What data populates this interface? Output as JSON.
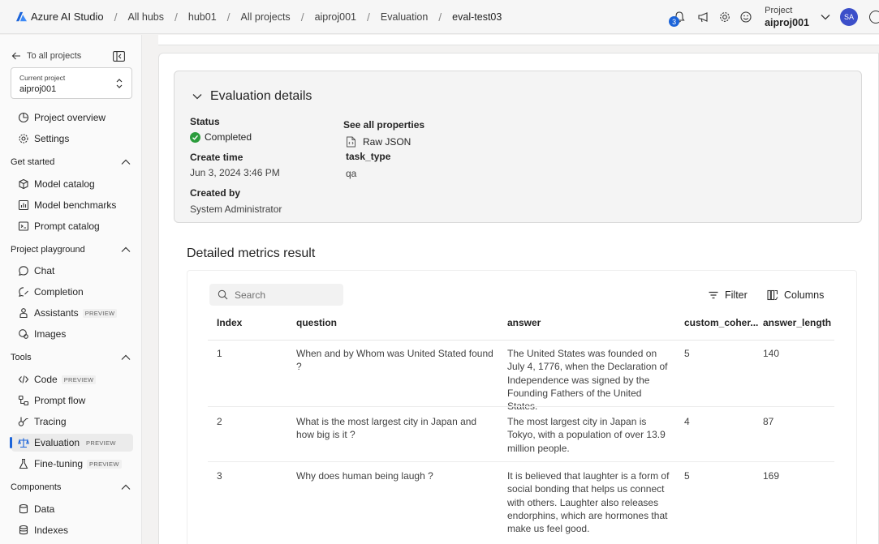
{
  "app": {
    "name": "Azure AI Studio"
  },
  "breadcrumbs": [
    "All hubs",
    "hub01",
    "All projects",
    "aiproj001",
    "Evaluation",
    "eval-test03"
  ],
  "topbar": {
    "notification_count": "3",
    "project_label": "Project",
    "project_name": "aiproj001",
    "avatar_initials": "SA"
  },
  "sidebar": {
    "back_label": "To all projects",
    "current_project_label": "Current project",
    "current_project": "aiproj001",
    "top_items": [
      {
        "label": "Project overview",
        "icon": "overview-icon"
      },
      {
        "label": "Settings",
        "icon": "gear-icon"
      }
    ],
    "sections": [
      {
        "title": "Get started",
        "items": [
          {
            "label": "Model catalog",
            "icon": "model-catalog-icon",
            "preview": ""
          },
          {
            "label": "Model benchmarks",
            "icon": "benchmarks-icon",
            "preview": ""
          },
          {
            "label": "Prompt catalog",
            "icon": "prompt-catalog-icon",
            "preview": ""
          }
        ]
      },
      {
        "title": "Project playground",
        "items": [
          {
            "label": "Chat",
            "icon": "chat-icon",
            "preview": ""
          },
          {
            "label": "Completion",
            "icon": "completion-icon",
            "preview": ""
          },
          {
            "label": "Assistants",
            "icon": "assistants-icon",
            "preview": "PREVIEW"
          },
          {
            "label": "Images",
            "icon": "images-icon",
            "preview": ""
          }
        ]
      },
      {
        "title": "Tools",
        "items": [
          {
            "label": "Code",
            "icon": "code-icon",
            "preview": "PREVIEW"
          },
          {
            "label": "Prompt flow",
            "icon": "prompt-flow-icon",
            "preview": ""
          },
          {
            "label": "Tracing",
            "icon": "tracing-icon",
            "preview": ""
          },
          {
            "label": "Evaluation",
            "icon": "evaluation-icon",
            "preview": "PREVIEW"
          },
          {
            "label": "Fine-tuning",
            "icon": "fine-tuning-icon",
            "preview": "PREVIEW"
          }
        ]
      },
      {
        "title": "Components",
        "items": [
          {
            "label": "Data",
            "icon": "data-icon",
            "preview": ""
          },
          {
            "label": "Indexes",
            "icon": "indexes-icon",
            "preview": ""
          }
        ]
      }
    ]
  },
  "details": {
    "title": "Evaluation details",
    "status_label": "Status",
    "status_value": "Completed",
    "create_time_label": "Create time",
    "create_time_value": "Jun 3, 2024 3:46 PM",
    "created_by_label": "Created by",
    "created_by_value": "System Administrator",
    "properties_label": "See all properties",
    "raw_json_label": "Raw JSON",
    "task_type_label": "task_type",
    "task_type_value": "qa"
  },
  "metrics": {
    "title": "Detailed metrics result",
    "search_placeholder": "Search",
    "filter_label": "Filter",
    "columns_label": "Columns",
    "headers": [
      "Index",
      "question",
      "answer",
      "custom_coher...",
      "answer_length"
    ],
    "rows": [
      {
        "index": "1",
        "question": "When and by Whom was United Stated found ?",
        "answer": "The United States was founded on July 4, 1776, when the Declaration of Independence was signed by the Founding Fathers of the United States.",
        "coherence": "5",
        "answer_length": "140"
      },
      {
        "index": "2",
        "question": "What is the most largest city in Japan and how big is it ?",
        "answer": "The most largest city in Japan is Tokyo, with a population of over 13.9 million people.",
        "coherence": "4",
        "answer_length": "87"
      },
      {
        "index": "3",
        "question": "Why does human being laugh ?",
        "answer": "It is believed that laughter is a form of social bonding that helps us connect with others. Laughter also releases endorphins, which are hormones that make us feel good.",
        "coherence": "5",
        "answer_length": "169"
      }
    ]
  }
}
